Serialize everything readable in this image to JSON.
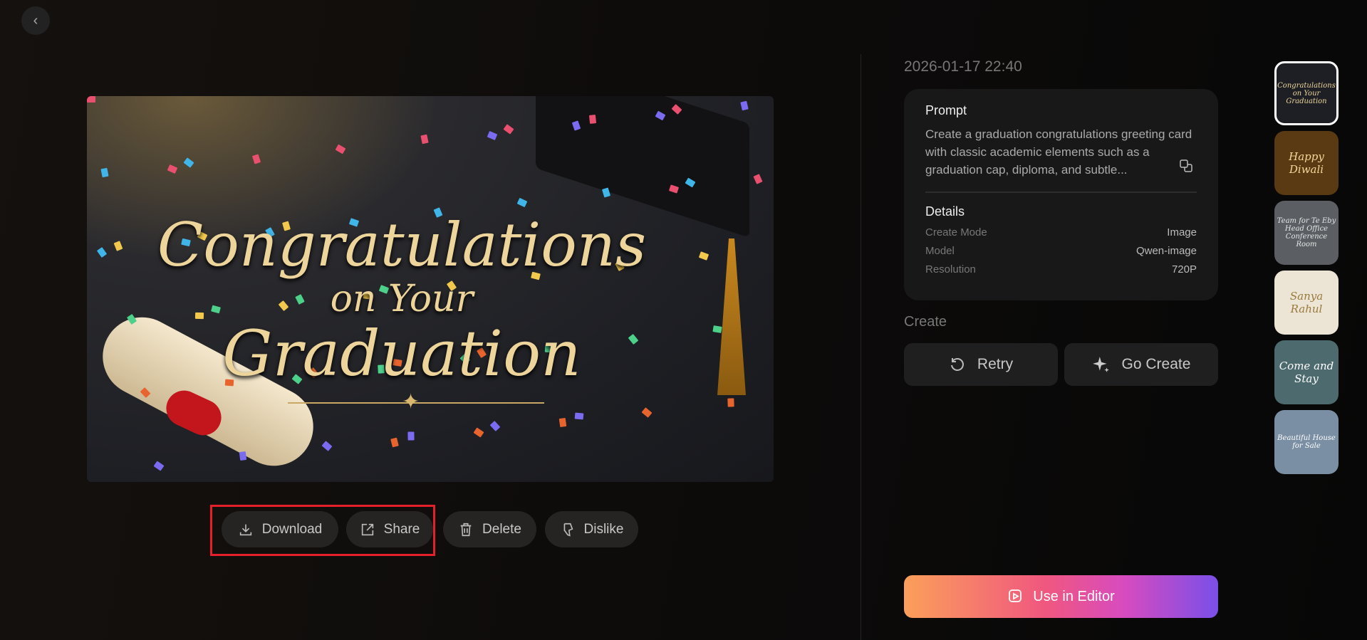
{
  "nav": {
    "back_icon": "chevron-left-icon"
  },
  "hero": {
    "line1": "Congratulations",
    "line2": "on Your",
    "line3": "Graduation"
  },
  "actions": [
    {
      "label": "Download",
      "icon": "download-icon"
    },
    {
      "label": "Share",
      "icon": "share-icon"
    },
    {
      "label": "Delete",
      "icon": "trash-icon"
    },
    {
      "label": "Dislike",
      "icon": "thumbs-down-icon"
    }
  ],
  "info": {
    "date": "2026-01-17 22:40",
    "prompt_title": "Prompt",
    "prompt": "Create a graduation congratulations greeting card with classic academic elements such as a graduation cap, diploma, and subtle...",
    "details_title": "Details",
    "details": [
      {
        "k": "Create Mode",
        "v": "Image"
      },
      {
        "k": "Model",
        "v": "Qwen-image"
      },
      {
        "k": "Resolution",
        "v": "720P"
      }
    ]
  },
  "create": {
    "label": "Create",
    "retry": "Retry",
    "go_create": "Go Create",
    "use_in_editor": "Use in Editor"
  },
  "thumbnails": [
    {
      "text": "Congratulations on Your Graduation",
      "bg": "#1e1f24",
      "fg": "#ecd49a"
    },
    {
      "text": "Happy Diwali",
      "bg": "#5a3a12",
      "fg": "#f2d79a"
    },
    {
      "text": "Team for Te Eby Head Office Conference Room",
      "bg": "#5b5f63",
      "fg": "#e6e6e6"
    },
    {
      "text": "Sanya Rahul",
      "bg": "#ece5d6",
      "fg": "#9a7a3a"
    },
    {
      "text": "Come and Stay",
      "bg": "#4d6a6e",
      "fg": "#ffffff"
    },
    {
      "text": "Beautiful House for Sale",
      "bg": "#7a8ea4",
      "fg": "#ffffff"
    }
  ]
}
